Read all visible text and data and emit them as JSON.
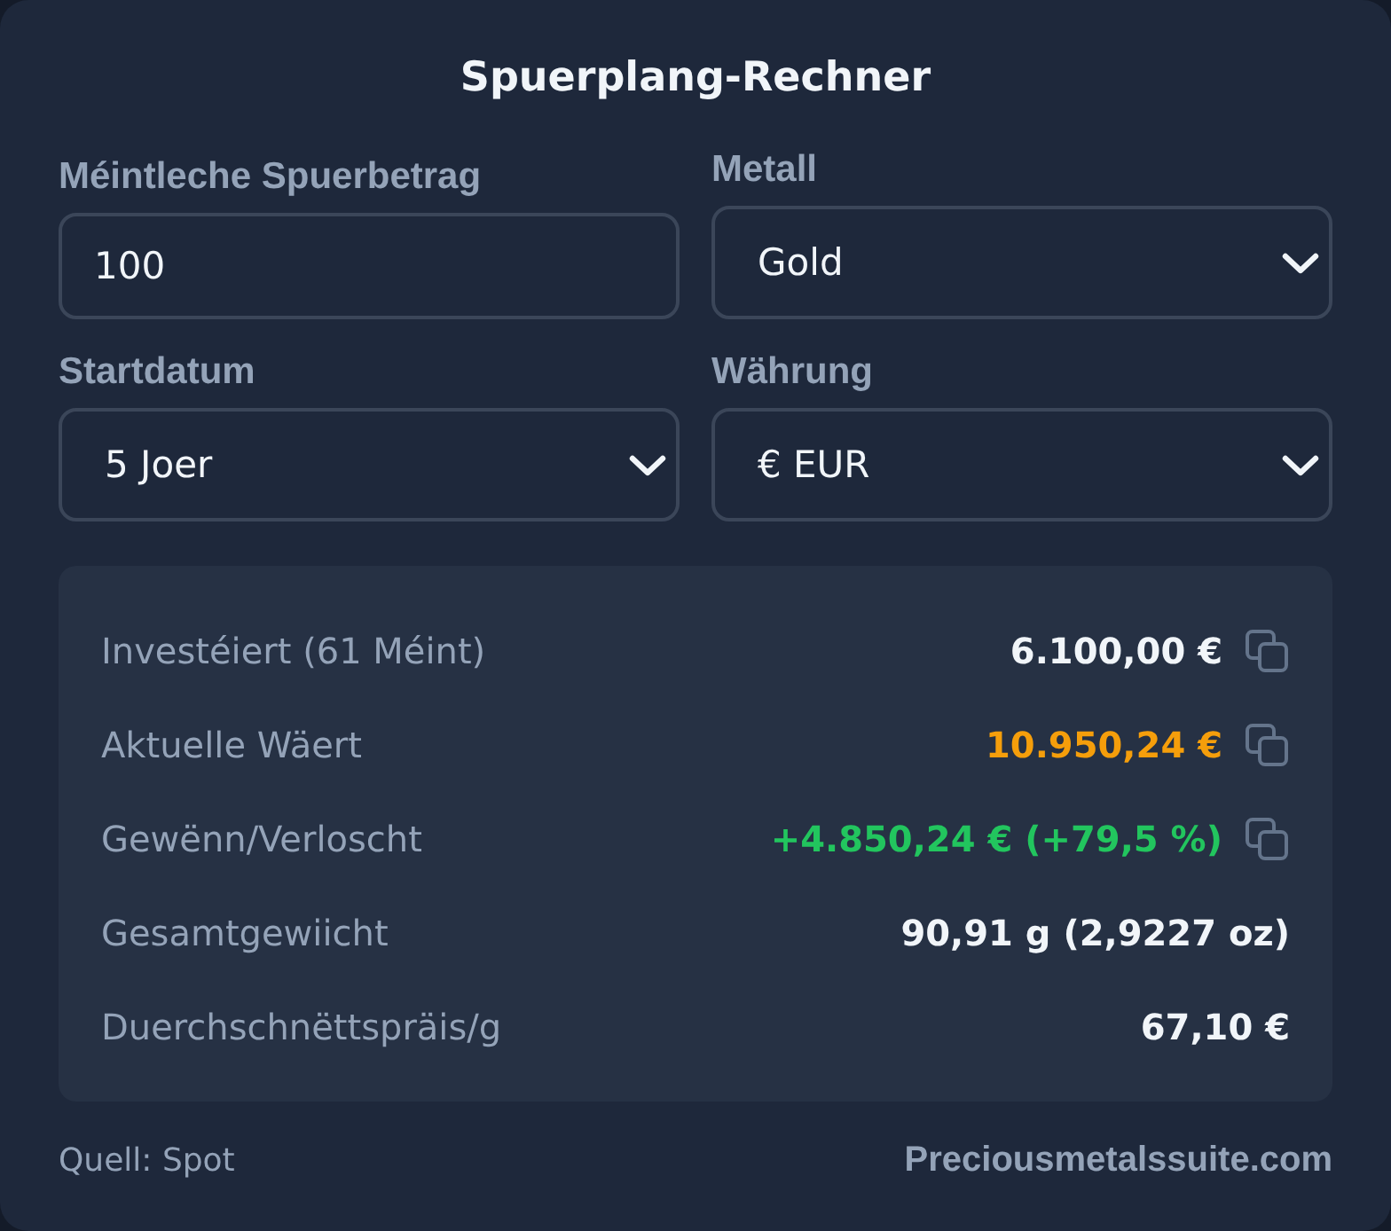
{
  "title": "Spuerplang-Rechner",
  "fields": [
    {
      "kind": "input",
      "label": "Méintleche Spuerbetrag",
      "value": "100"
    },
    {
      "kind": "select",
      "label": "Metall",
      "value": "Gold"
    },
    {
      "kind": "select",
      "label": "Startdatum",
      "value": "5 Joer"
    },
    {
      "kind": "select",
      "label": "Währung",
      "value": "€ EUR"
    }
  ],
  "results": [
    {
      "label": "Investéiert (61 Méint)",
      "value": "6.100,00 €",
      "color": "#f1f5f9",
      "copy": true
    },
    {
      "label": "Aktuelle Wäert",
      "value": "10.950,24 €",
      "color": "#f59e0b",
      "copy": true
    },
    {
      "label": "Gewënn/Verloscht",
      "value": "+4.850,24 € (+79,5 %)",
      "color": "#22c55e",
      "copy": true
    },
    {
      "label": "Gesamtgewiicht",
      "value": "90,91 g (2,9227 oz)",
      "color": "#f1f5f9",
      "copy": false
    },
    {
      "label": "Duerchschnëttspräis/g",
      "value": "67,10 €",
      "color": "#f1f5f9",
      "copy": false
    }
  ],
  "footer": {
    "source": "Quell: Spot",
    "link": "Preciousmetalssuite.com"
  }
}
